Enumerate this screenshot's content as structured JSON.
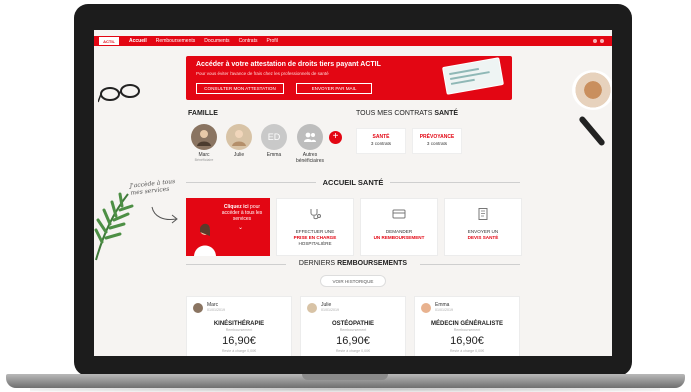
{
  "nav": {
    "brand": "ACTIL",
    "items": [
      "Accueil",
      "Remboursements",
      "Documents",
      "Contrats",
      "Profil"
    ]
  },
  "banner": {
    "title": "Accéder à votre attestation de droits tiers payant ACTIL",
    "subtitle": "Pour vous éviter l'avance de frais chez les professionnels de santé",
    "btn_consult": "CONSULTER MON ATTESTATION",
    "btn_mail": "ENVOYER PAR MAIL"
  },
  "famille": {
    "title": "FAMILLE",
    "members": [
      {
        "name": "Marc",
        "sub": "Bénéficiaire"
      },
      {
        "name": "Julie",
        "sub": ""
      },
      {
        "name": "Emma",
        "sub": "",
        "initials": "ED"
      },
      {
        "name": "Autres bénéficiaires",
        "sub": ""
      }
    ],
    "add": "+"
  },
  "contrats": {
    "title_pre": "TOUS MES CONTRATS",
    "title_bold": "SANTÉ",
    "items": [
      {
        "name": "SANTÉ",
        "count": "3 contrats"
      },
      {
        "name": "PRÉVOYANCE",
        "count": "3 contrats"
      }
    ]
  },
  "note": {
    "text": "J'accède à tous mes services"
  },
  "accueil": {
    "title": "ACCUEIL SANTÉ",
    "red_tile": {
      "bold": "Cliquez ici",
      "rest": "pour accéder à tous les services",
      "chev": "⌄"
    },
    "tiles": [
      {
        "l1": "EFFECTUER UNE",
        "bold": "PRISE EN CHARGE",
        "l3": "HOSPITALIÈRE"
      },
      {
        "l1": "DEMANDER",
        "bold": "UN REMBOURSEMENT",
        "l3": ""
      },
      {
        "l1": "ENVOYER UN",
        "bold": "DEVIS SANTÉ",
        "l3": ""
      }
    ]
  },
  "remboursements": {
    "title_pre": "DERNIERS",
    "title_bold": "REMBOURSEMENTS",
    "history_btn": "VOIR HISTORIQUE",
    "cards": [
      {
        "name": "Marc",
        "date": "01/01/2019",
        "type": "KINÉSITHÉRAPIE",
        "sub": "Remboursement",
        "amount": "16,90€",
        "foot": "Reste à charge  0,00€"
      },
      {
        "name": "Julie",
        "date": "01/01/2019",
        "type": "OSTÉOPATHIE",
        "sub": "Remboursement",
        "amount": "16,90€",
        "foot": "Reste à charge  0,00€"
      },
      {
        "name": "Emma",
        "date": "01/01/2019",
        "type": "MÉDECIN GÉNÉRALISTE",
        "sub": "Remboursement",
        "amount": "16,90€",
        "foot": "Reste à charge  0,00€"
      }
    ]
  },
  "colors": {
    "accent": "#e30613",
    "background": "#f6f4f2"
  }
}
